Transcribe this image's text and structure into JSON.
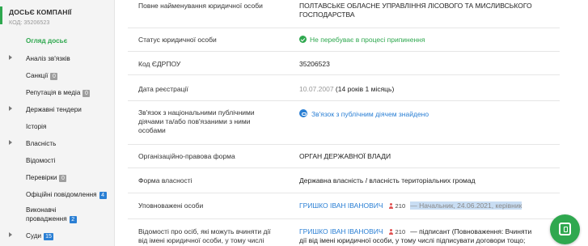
{
  "sidebar": {
    "title": "ДОСЬЄ КОМПАНІЇ",
    "code": "КОД: 35206523",
    "items": [
      {
        "label": "Огляд досьє",
        "active": true
      },
      {
        "label": "Аналіз зв'язків",
        "arrow": true
      },
      {
        "label": "Санкції",
        "badge": "0",
        "badge_color": "gray"
      },
      {
        "label": "Репутація в медіа",
        "badge": "0",
        "badge_color": "gray"
      },
      {
        "label": "Державні тендери",
        "arrow": true
      },
      {
        "label": "Історія"
      },
      {
        "label": "Власність",
        "arrow": true
      },
      {
        "label": "Відомості"
      },
      {
        "label": "Перевірки",
        "badge": "0",
        "badge_color": "gray"
      },
      {
        "label": "Офіційні повідомлення",
        "badge": "4",
        "badge_color": "blue"
      },
      {
        "label_line1": "Виконавчі",
        "label_line2": "провадження",
        "badge": "2",
        "badge_color": "blue"
      },
      {
        "label": "Суди",
        "badge": "15",
        "badge_color": "blue",
        "arrow": true
      }
    ]
  },
  "details": {
    "full_name": {
      "key": "Повне найменування юридичної особи",
      "value_line1": "ПОЛТАВСЬКЕ ОБЛАСНЕ УПРАВЛІННЯ ЛІСОВОГО ТА МИСЛИВСЬКОГО",
      "value_line2": "ГОСПОДАРСТВА"
    },
    "status": {
      "key": "Статус юридичної особи",
      "value": "Не перебуває в процесі припинення"
    },
    "edrpou": {
      "key": "Код ЄДРПОУ",
      "value": "35206523"
    },
    "reg_date": {
      "key": "Дата реєстрації",
      "date": "10.07.2007",
      "age": "(14 років 1 місяць)"
    },
    "pep": {
      "key_line1": "Зв'язок з національними публічними",
      "key_line2": "діячами та/або пов'язаними з ними",
      "key_line3": "особами",
      "value": "Зв'язок з публічним діячем знайдено"
    },
    "legal_form": {
      "key": "Організаційно-правова форма",
      "value": "ОРГАН ДЕРЖАВНОЇ ВЛАДИ"
    },
    "ownership": {
      "key": "Форма власності",
      "value": "Державна власність / власність територіальних громад"
    },
    "authorized": {
      "key": "Уповноважені особи",
      "person": "ГРИШКО ІВАН ІВАНОВИЧ",
      "count": "210",
      "note": "— Начальник, 24.06.2021, керівник"
    },
    "signers": {
      "key_line1": "Відомості про осіб, які можуть вчиняти дії",
      "key_line2": "від імені юридичної особи, у тому числі",
      "person": "ГРИШКО ІВАН ІВАНОВИЧ",
      "count": "210",
      "note_line1": "— підписант (Повноваження: Вчиняти",
      "note_line2": "дії від імені юридичної особи, у тому числі підписувати договори тощо;"
    }
  },
  "icons": {
    "status": "check-circle-icon",
    "pep": "link-icon",
    "person": "person-icon",
    "chat": "chat-icon"
  },
  "colors": {
    "accent_green": "#2fa84f",
    "link_blue": "#2a7fd4",
    "badge_gray": "#9e9e9e",
    "highlight": "#c8ddf3"
  }
}
